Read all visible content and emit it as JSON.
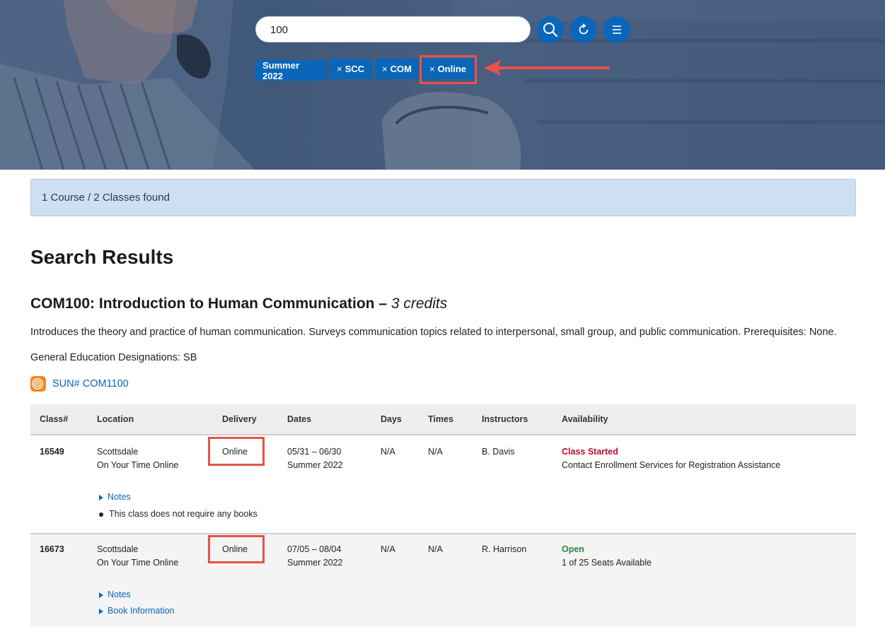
{
  "search": {
    "value": "100"
  },
  "icons": {
    "search": "search-icon",
    "reset": "refresh-icon",
    "menu": "menu-icon",
    "sun_logo": "sun-logo-icon"
  },
  "filters": [
    {
      "label": "Summer 2022",
      "removable": false
    },
    {
      "label": "SCC",
      "removable": true
    },
    {
      "label": "COM",
      "removable": true
    },
    {
      "label": "Online",
      "removable": true
    }
  ],
  "filter_remove_glyph": "×",
  "results_summary": "1 Course / 2 Classes found",
  "page_title": "Search Results",
  "course": {
    "code_title": "COM100: Introduction to Human Communication",
    "separator": " – ",
    "credits": "3 credits",
    "description": "Introduces the theory and practice of human communication. Surveys communication topics related to interpersonal, small group, and public communication. Prerequisites: None.",
    "gen_ed": "General Education Designations: SB",
    "sun_link": "SUN# COM1100"
  },
  "table": {
    "headers": [
      "Class#",
      "Location",
      "Delivery",
      "Dates",
      "Days",
      "Times",
      "Instructors",
      "Availability"
    ],
    "rows": [
      {
        "class_num": "16549",
        "location": "Scottsdale",
        "location_sub": "On Your Time Online",
        "delivery": "Online",
        "dates": "05/31 – 06/30",
        "term": "Summer 2022",
        "days": "N/A",
        "times": "N/A",
        "instructor": "B. Davis",
        "status": "Class Started",
        "status_detail": "Contact Enrollment Services for Registration Assistance",
        "notes_label": "Notes",
        "books_text": "This class does not require any books"
      },
      {
        "class_num": "16673",
        "location": "Scottsdale",
        "location_sub": "On Your Time Online",
        "delivery": "Online",
        "dates": "07/05 – 08/04",
        "term": "Summer 2022",
        "days": "N/A",
        "times": "N/A",
        "instructor": "R. Harrison",
        "status": "Open",
        "status_detail": "1 of 25 Seats Available",
        "notes_label": "Notes",
        "books_label": "Book Information"
      }
    ]
  },
  "colors": {
    "primary": "#0a66b8",
    "annotation": "#e8524a",
    "started": "#b3102e",
    "open": "#2e8540"
  }
}
